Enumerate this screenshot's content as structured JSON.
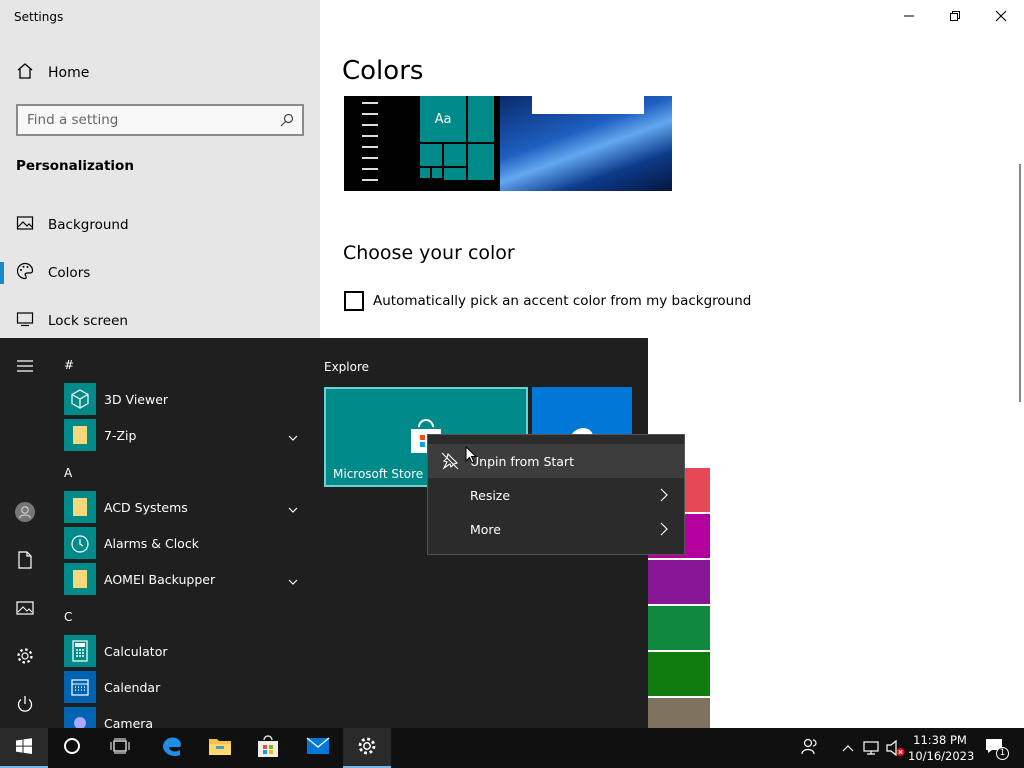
{
  "window": {
    "title": "Settings",
    "controls": [
      "minimize-icon",
      "restore-icon",
      "close-icon"
    ]
  },
  "sidebar": {
    "home_label": "Home",
    "search_placeholder": "Find a setting",
    "section_heading": "Personalization",
    "items": [
      {
        "label": "Background",
        "icon": "picture-icon"
      },
      {
        "label": "Colors",
        "icon": "palette-icon",
        "active": true
      },
      {
        "label": "Lock screen",
        "icon": "monitor-icon"
      }
    ]
  },
  "main": {
    "title": "Colors",
    "preview_tile_text": "Aa",
    "choose_heading": "Choose your color",
    "auto_accent_label": "Automatically pick an accent color from my background",
    "auto_accent_checked": false,
    "swatch_colors": [
      "#e74856",
      "#b4009e",
      "#881798",
      "#10893e",
      "#107c10",
      "#7e735f"
    ]
  },
  "start_menu": {
    "sections": [
      {
        "letter": "#",
        "apps": [
          {
            "label": "3D Viewer",
            "icon": "cube-icon",
            "expandable": false
          },
          {
            "label": "7-Zip",
            "icon": "folder-icon",
            "expandable": true
          }
        ]
      },
      {
        "letter": "A",
        "apps": [
          {
            "label": "ACD Systems",
            "icon": "folder-icon",
            "expandable": true
          },
          {
            "label": "Alarms & Clock",
            "icon": "clock-icon",
            "expandable": false
          },
          {
            "label": "AOMEI Backupper",
            "icon": "folder-icon",
            "expandable": true
          }
        ]
      },
      {
        "letter": "C",
        "apps": [
          {
            "label": "Calculator",
            "icon": "calculator-icon",
            "expandable": false
          },
          {
            "label": "Calendar",
            "icon": "calendar-icon",
            "expandable": false
          },
          {
            "label": "Camera",
            "icon": "camera-icon",
            "expandable": false
          }
        ]
      }
    ],
    "group_title": "Explore",
    "tiles": [
      {
        "label": "Microsoft Store",
        "icon": "store-bag-icon"
      },
      {
        "label": "",
        "icon": "edge-icon"
      }
    ]
  },
  "context_menu": {
    "items": [
      {
        "label": "Unpin from Start",
        "icon": "unpin-icon",
        "submenu": false
      },
      {
        "label": "Resize",
        "submenu": true
      },
      {
        "label": "More",
        "submenu": true
      }
    ]
  },
  "taskbar": {
    "time": "11:38 PM",
    "date": "10/16/2023",
    "notification_count": "1"
  }
}
